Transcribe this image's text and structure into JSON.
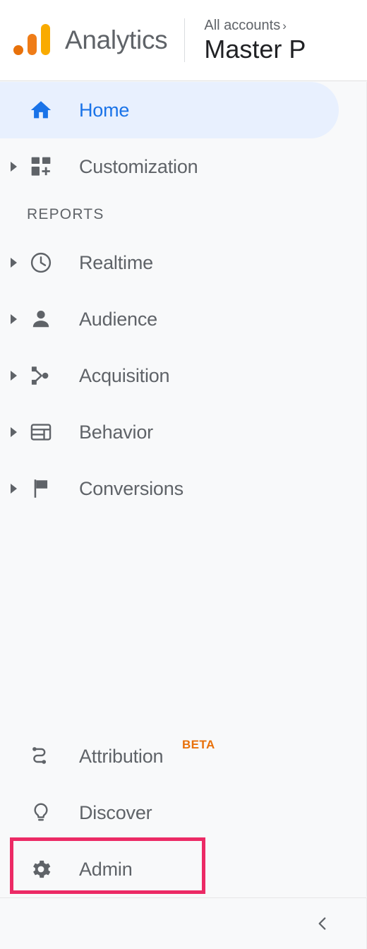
{
  "header": {
    "logo_icon": "google-analytics-logo",
    "product_title": "Analytics",
    "breadcrumb": "All accounts",
    "breadcrumb_arrow": "›",
    "account_name": "Master P",
    "colors": {
      "logo_dot": "#e8710a",
      "logo_mid_bar": "#ef7c17",
      "logo_tall_bar": "#f9ab00",
      "title_text": "#5f6368",
      "account_text": "#202124"
    }
  },
  "sidebar": {
    "primary": [
      {
        "id": "home",
        "label": "Home",
        "icon": "home-icon",
        "active": true,
        "expandable": false
      },
      {
        "id": "customization",
        "label": "Customization",
        "icon": "customization-icon",
        "active": false,
        "expandable": true
      }
    ],
    "section_label": "REPORTS",
    "reports": [
      {
        "id": "realtime",
        "label": "Realtime",
        "icon": "clock-icon",
        "expandable": true
      },
      {
        "id": "audience",
        "label": "Audience",
        "icon": "person-icon",
        "expandable": true
      },
      {
        "id": "acquisition",
        "label": "Acquisition",
        "icon": "acquisition-node-icon",
        "expandable": true
      },
      {
        "id": "behavior",
        "label": "Behavior",
        "icon": "behavior-layout-icon",
        "expandable": true
      },
      {
        "id": "conversions",
        "label": "Conversions",
        "icon": "flag-icon",
        "expandable": true
      }
    ],
    "bottom": [
      {
        "id": "attribution",
        "label": "Attribution",
        "icon": "attribution-path-icon",
        "badge": "BETA"
      },
      {
        "id": "discover",
        "label": "Discover",
        "icon": "lightbulb-icon",
        "badge": ""
      },
      {
        "id": "admin",
        "label": "Admin",
        "icon": "gear-icon",
        "badge": ""
      }
    ],
    "colors": {
      "background": "#f8f9fa",
      "active_background": "#e8f0fe",
      "active_text": "#1a73e8",
      "label_text": "#5f6368",
      "beta_badge": "#e8710a"
    }
  },
  "annotation": {
    "target": "Admin",
    "color": "#ec2a65"
  },
  "footer": {
    "collapse_icon": "chevron-left-icon"
  }
}
